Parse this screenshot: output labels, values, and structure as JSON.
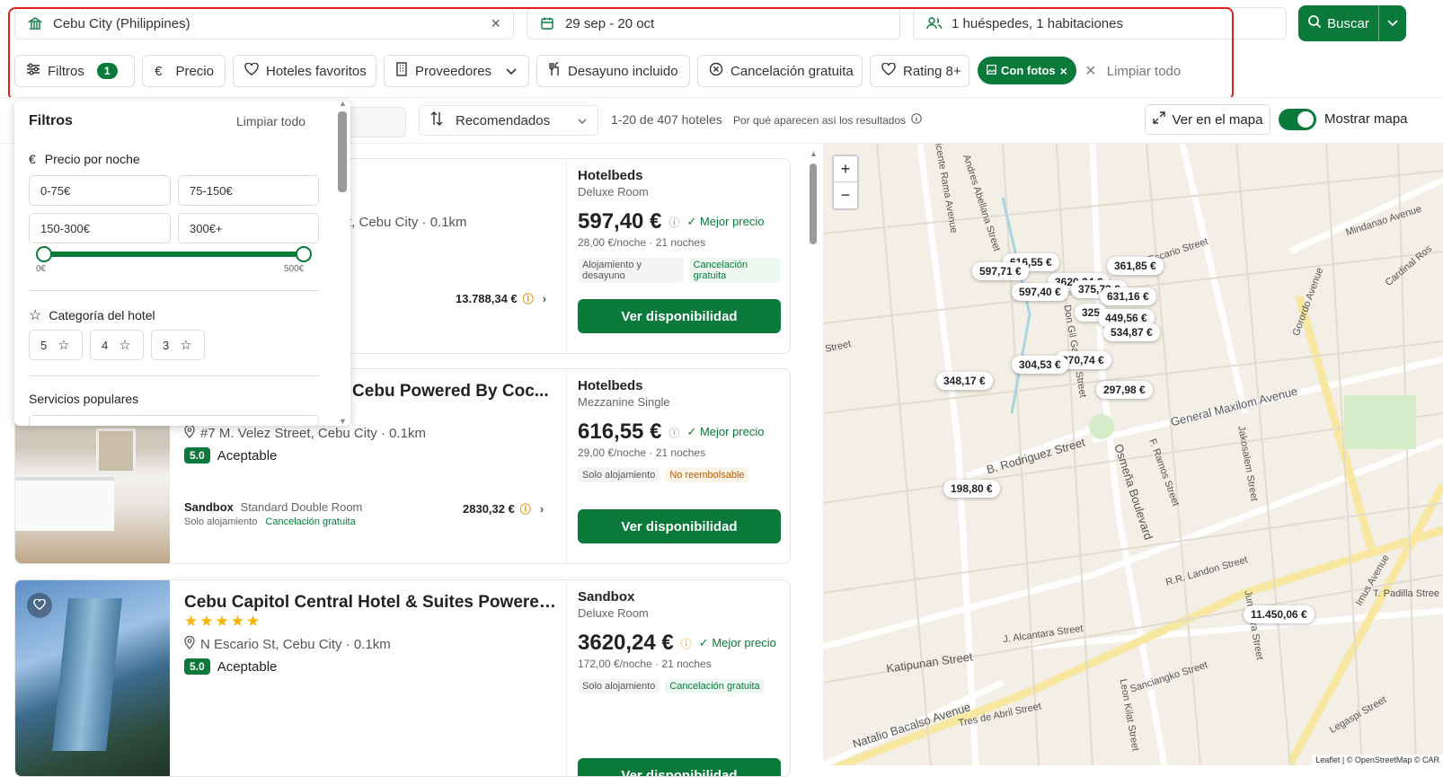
{
  "search": {
    "location": "Cebu City (Philippines)",
    "dates": "29 sep - 20 oct",
    "guests": "1 huéspedes, 1 habitaciones",
    "search_button": "Buscar"
  },
  "filters_bar": {
    "filtros_label": "Filtros",
    "filtros_count": "1",
    "precio": "Precio",
    "favoritos": "Hoteles favoritos",
    "proveedores": "Proveedores",
    "desayuno": "Desayuno incluido",
    "cancelacion": "Cancelación gratuita",
    "rating": "Rating 8+",
    "con_fotos": "Con fotos",
    "limpiar": "Limpiar todo"
  },
  "toolbar": {
    "sort": "Recomendados",
    "count": "1-20 de 407 hoteles",
    "why": "Por qué aparecen así los resultados",
    "ver_mapa": "Ver en el mapa",
    "mostrar_mapa": "Mostrar mapa"
  },
  "panel": {
    "title": "Filtros",
    "clear": "Limpiar todo",
    "price_title": "Precio por noche",
    "price_opts": [
      "0-75€",
      "75-150€",
      "150-300€",
      "300€+"
    ],
    "slider_min": "0€",
    "slider_max": "500€",
    "category_title": "Categoría del hotel",
    "stars": [
      "5",
      "4",
      "3"
    ],
    "servicios_title": "Servicios populares"
  },
  "cards": [
    {
      "title": "",
      "address": "t, Cebu City · 0.1km",
      "alt_price": "13.788,34 €",
      "provider": "Hotelbeds",
      "room": "Deluxe Room",
      "price": "597,40 €",
      "mejor": "Mejor precio",
      "pernight": "28,00 €/noche · 21 noches",
      "tag1": "Alojamiento y desayuno",
      "tag2": "Cancelación gratuita",
      "button": "Ver disponibilidad"
    },
    {
      "title": "otel Cebu Powered By Coc...",
      "address": "#7 M. Velez Street, Cebu City · 0.1km",
      "score": "5.0",
      "score_label": "Aceptable",
      "alt_provider": "Sandbox",
      "alt_room": "Standard Double Room",
      "alt_board": "Solo alojamiento",
      "alt_cancel": "Cancelación gratuita",
      "alt_price": "2830,32 €",
      "provider": "Hotelbeds",
      "room": "Mezzanine Single",
      "price": "616,55 €",
      "mejor": "Mejor precio",
      "pernight": "29,00 €/noche · 21 noches",
      "tag1": "Solo alojamiento",
      "tag2": "No reembolsable",
      "button": "Ver disponibilidad"
    },
    {
      "title": "Cebu Capitol Central Hotel & Suites Powered By...",
      "address": "N Escario St, Cebu City · 0.1km",
      "score": "5.0",
      "score_label": "Aceptable",
      "provider": "Sandbox",
      "room": "Deluxe Room",
      "price": "3620,24 €",
      "mejor": "Mejor precio",
      "pernight": "172,00 €/noche · 21 noches",
      "tag1": "Solo alojamiento",
      "tag2": "Cancelación gratuita",
      "button": "Ver disponibilidad"
    }
  ],
  "map": {
    "zoom_in": "+",
    "zoom_out": "−",
    "pins": [
      "616,55 €",
      "597,71 €",
      "597,40 €",
      "3620,24 €",
      "375,73 €",
      "361,85 €",
      "631,16 €",
      "325",
      "449,56 €",
      "534,87 €",
      "304,53 €",
      "370,74 €",
      "348,17 €",
      "297,98 €",
      "198,80 €",
      "11.450,06 €"
    ],
    "streets": [
      "Vicente Rama Avenue",
      "Andres Abellana Street",
      "Don Gil Garcia Street",
      "N Escario Street",
      "General Maxilom Avenue",
      "B. Rodriguez Street",
      "Osmeña Boulevard",
      "F. Ramos Street",
      "R.R. Landon Street",
      "Katipunan Street",
      "Natalio Bacalso Avenue",
      "J. Alcantara Street",
      "Sanciangko Street",
      "Gorordo Avenue",
      "Imus Avenue",
      "Mindanao Avenue",
      "Cardinal Ros",
      "Jakosalem Street",
      "Junquera Street",
      "T. Padilla Stree",
      "Legaspi Street",
      "Tres de Abril Street",
      "Leon Kilat Street",
      "Street"
    ],
    "attribution": "Leaflet | © OpenStreetMap © CAR"
  }
}
